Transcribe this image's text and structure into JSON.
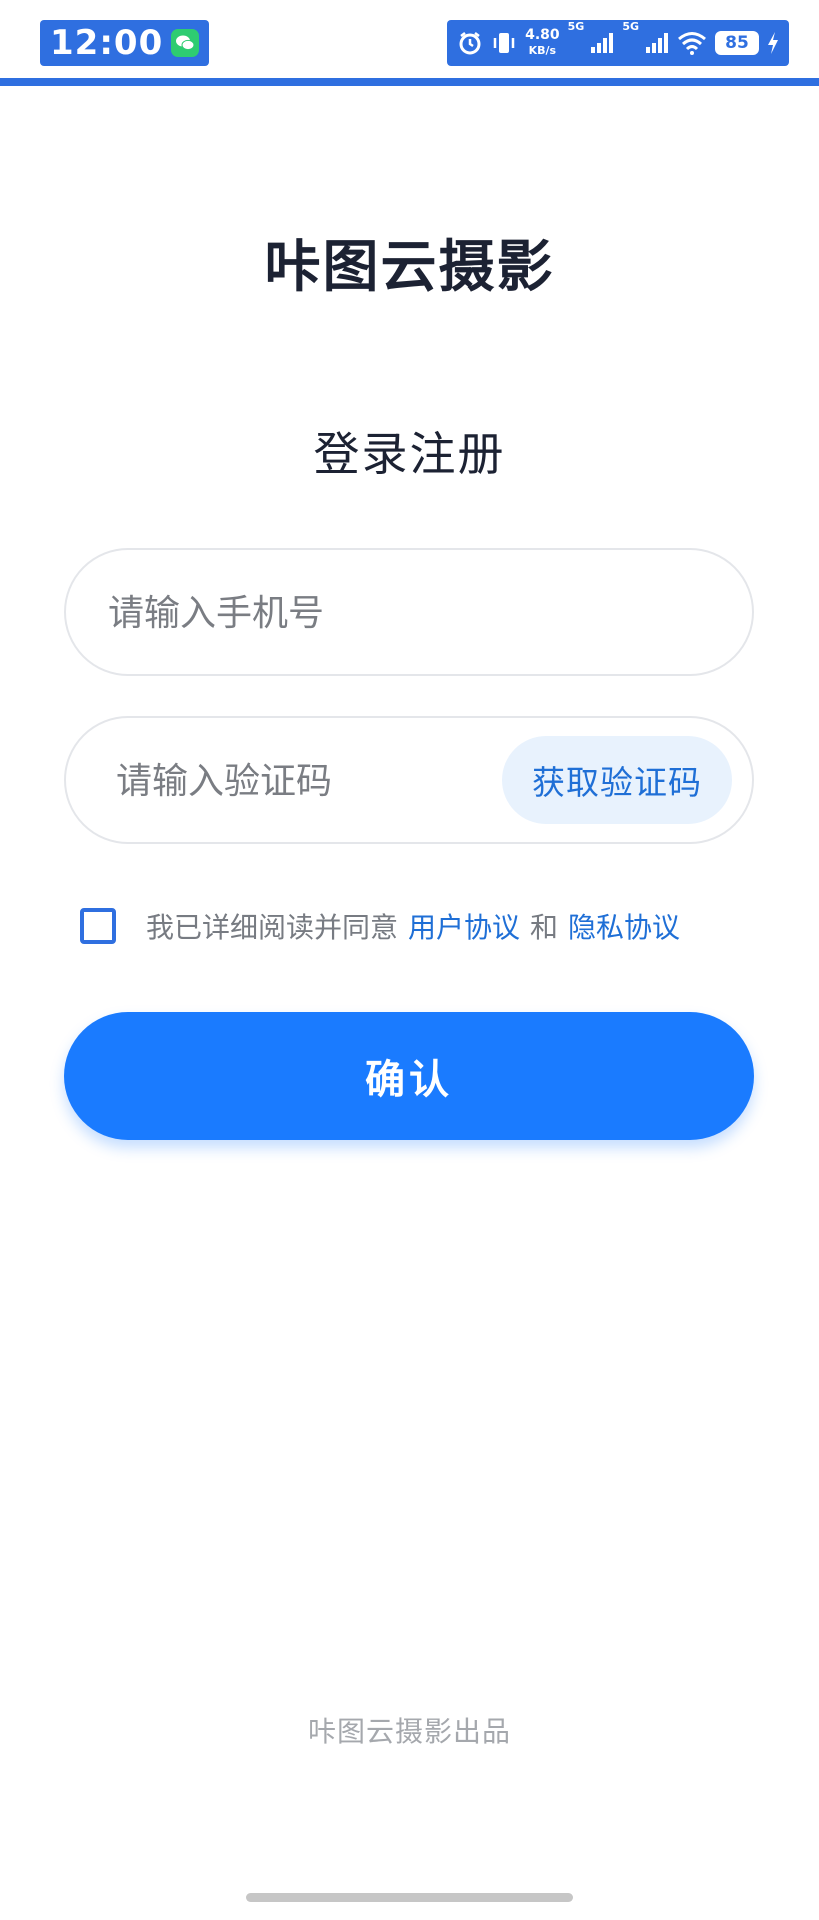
{
  "status_bar": {
    "time": "12:00",
    "net_speed_value": "4.80",
    "net_speed_unit": "KB/s",
    "sim1_label": "5G",
    "sim2_label": "5G",
    "battery": "85",
    "icons": [
      "wechat-icon",
      "alarm-icon",
      "vibrate-icon",
      "signal-icon",
      "wifi-icon",
      "battery-icon",
      "charging-icon"
    ],
    "accent_color": "#2f6fe0"
  },
  "app": {
    "title": "咔图云摄影"
  },
  "login": {
    "heading": "登录注册",
    "phone_placeholder": "请输入手机号",
    "code_placeholder": "请输入验证码",
    "get_code_label": "获取验证码",
    "agreement_prefix": "我已详细阅读并同意",
    "user_agreement_label": "用户协议",
    "agreement_conjunction": "和",
    "privacy_policy_label": "隐私协议",
    "confirm_label": "确认",
    "primary_color": "#1a7bff",
    "link_color": "#1f6fd6"
  },
  "footer": {
    "credit": "咔图云摄影出品"
  }
}
